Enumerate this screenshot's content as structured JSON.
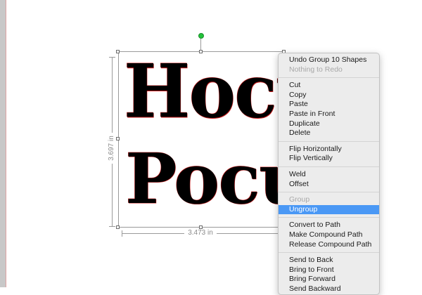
{
  "artwork": {
    "line1": "Hocus",
    "line2": "Pocus",
    "height_label": "3.697 in",
    "width_label": "3.473 in"
  },
  "context_menu": {
    "undo": "Undo Group 10 Shapes",
    "redo": "Nothing to Redo",
    "cut": "Cut",
    "copy": "Copy",
    "paste": "Paste",
    "paste_in_front": "Paste in Front",
    "duplicate": "Duplicate",
    "delete": "Delete",
    "flip_horizontally": "Flip Horizontally",
    "flip_vertically": "Flip Vertically",
    "weld": "Weld",
    "offset": "Offset",
    "group": "Group",
    "ungroup": "Ungroup",
    "convert_to_path": "Convert to Path",
    "make_compound_path": "Make Compound Path",
    "release_compound_path": "Release Compound Path",
    "send_to_back": "Send to Back",
    "bring_to_front": "Bring to Front",
    "bring_forward": "Bring Forward",
    "send_backward": "Send Backward"
  },
  "colors": {
    "highlight": "#4a98f5",
    "rotate_handle": "#22c33a",
    "text_outline": "#d02020"
  }
}
